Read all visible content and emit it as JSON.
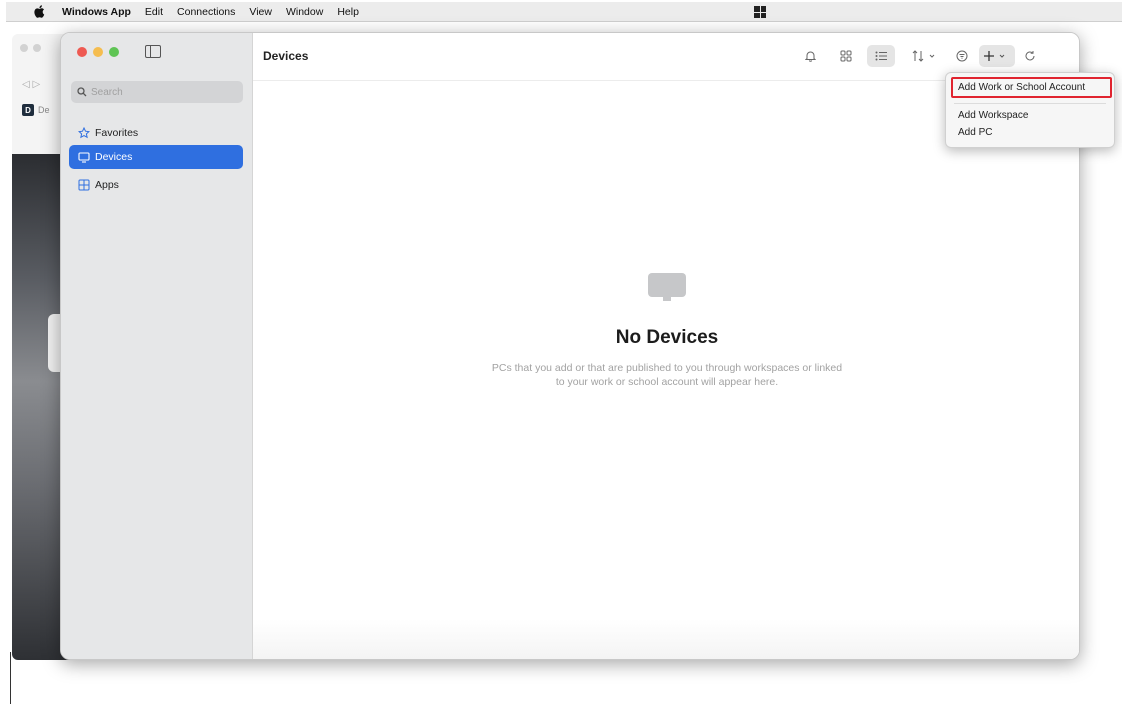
{
  "menubar": {
    "app_name": "Windows App",
    "items": [
      "Edit",
      "Connections",
      "View",
      "Window",
      "Help"
    ]
  },
  "background_browser": {
    "tab_initial": "D",
    "tab_text": "De"
  },
  "sidebar": {
    "search_placeholder": "Search",
    "items": [
      {
        "label": "Favorites",
        "icon": "star-icon",
        "active": false
      },
      {
        "label": "Devices",
        "icon": "monitor-icon",
        "active": true
      },
      {
        "label": "Apps",
        "icon": "apps-grid-icon",
        "active": false
      }
    ]
  },
  "toolbar": {
    "title": "Devices",
    "icons": [
      "bell-icon",
      "grid-view-icon",
      "list-view-icon",
      "sort-icon",
      "filter-icon",
      "add-icon",
      "refresh-icon"
    ]
  },
  "empty_state": {
    "heading": "No Devices",
    "description": "PCs that you add or that are published to you through workspaces or linked to your work or school account will appear here."
  },
  "dropdown": {
    "items": [
      "Add Work or School Account",
      "Add Workspace",
      "Add PC"
    ],
    "highlight_color": "#e0242f"
  },
  "colors": {
    "accent": "#2f6fe0",
    "traffic_red": "#ee5a52",
    "traffic_yellow": "#f5bd4f",
    "traffic_green": "#5fc454"
  }
}
